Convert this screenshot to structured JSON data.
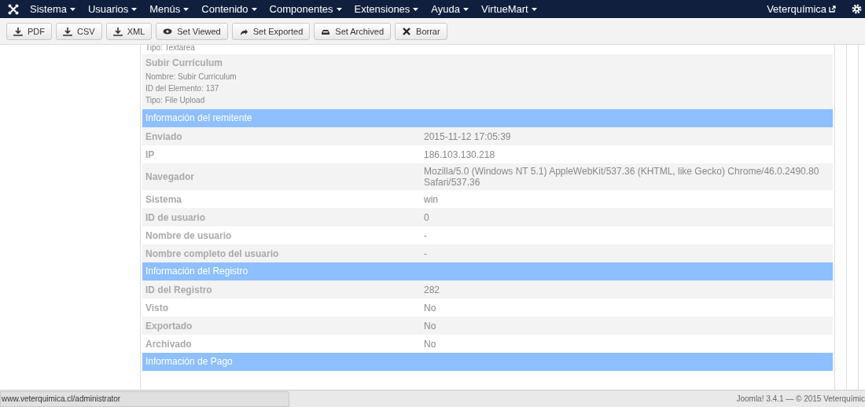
{
  "navbar": {
    "menus": [
      {
        "label": "Sistema"
      },
      {
        "label": "Usuarios"
      },
      {
        "label": "Menús"
      },
      {
        "label": "Contenido"
      },
      {
        "label": "Componentes"
      },
      {
        "label": "Extensiones"
      },
      {
        "label": "Ayuda"
      },
      {
        "label": "VirtueMart"
      }
    ],
    "site_link": "Veterquímica"
  },
  "toolbar": [
    {
      "label": "PDF",
      "kind": "download"
    },
    {
      "label": "CSV",
      "kind": "download"
    },
    {
      "label": "XML",
      "kind": "download"
    },
    {
      "label": "Set Viewed",
      "kind": "eye"
    },
    {
      "label": "Set Exported",
      "kind": "share"
    },
    {
      "label": "Set Archived",
      "kind": "archive"
    },
    {
      "label": "Borrar",
      "kind": "delete"
    }
  ],
  "field_block": {
    "cut_line": "Tipo: Textarea",
    "title": "Subir Currículum",
    "lines": [
      "Nombre: Subir Curriculum",
      "ID del Elemento: 137",
      "Tipo: File Upload"
    ]
  },
  "sections": [
    {
      "title": "Información del remitente",
      "rows": [
        {
          "label": "Enviado",
          "value": "2015-11-12 17:05:39"
        },
        {
          "label": "IP",
          "value": "186.103.130.218"
        },
        {
          "label": "Navegador",
          "value": "Mozilla/5.0 (Windows NT 5.1) AppleWebKit/537.36 (KHTML, like Gecko) Chrome/46.0.2490.80 Safari/537.36"
        },
        {
          "label": "Sistema",
          "value": "win"
        },
        {
          "label": "ID de usuario",
          "value": "0"
        },
        {
          "label": "Nombre de usuario",
          "value": "-"
        },
        {
          "label": "Nombre completo del usuario",
          "value": "-"
        }
      ]
    },
    {
      "title": "Información del Registro",
      "rows": [
        {
          "label": "ID del Registro",
          "value": "282"
        },
        {
          "label": "Visto",
          "value": "No"
        },
        {
          "label": "Exportado",
          "value": "No"
        },
        {
          "label": "Archivado",
          "value": "No"
        }
      ]
    },
    {
      "title": "Información de Pago"
    }
  ],
  "status_url": "www.veterquimica.cl/administrator",
  "footer": "Joomla! 3.4.1 — © 2015 Veterquímic"
}
